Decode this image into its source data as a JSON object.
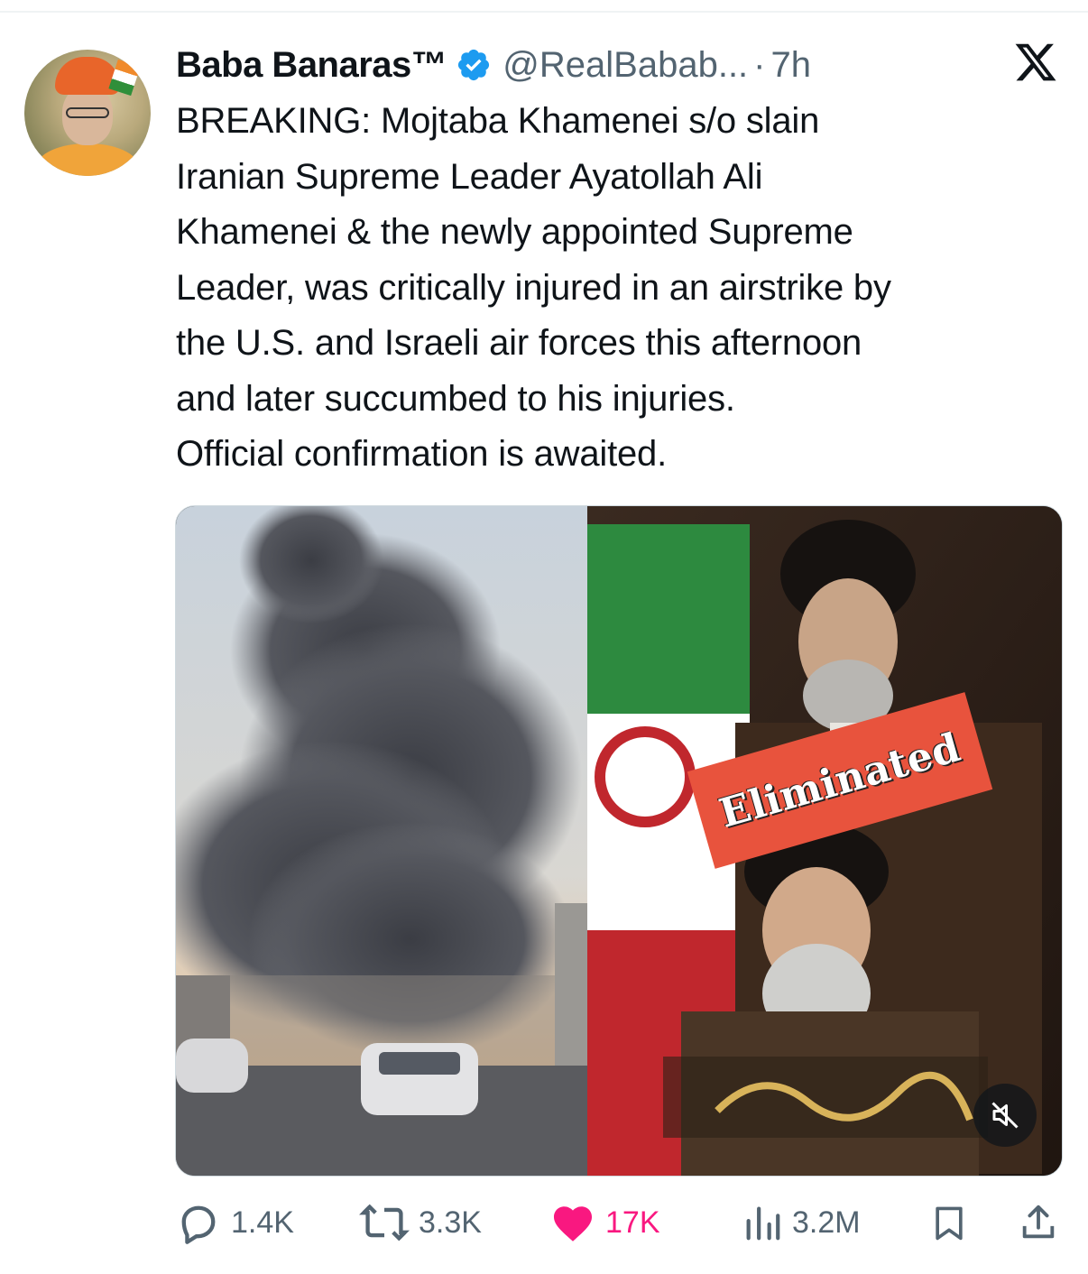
{
  "author": {
    "display_name": "Baba Banaras™",
    "handle": "@RealBabab...",
    "separator": "·",
    "time": "7h",
    "verified": true
  },
  "tweet": {
    "text": "BREAKING: Mojtaba Khamenei s/o slain\nIranian Supreme Leader Ayatollah Ali\nKhamenei & the newly appointed Supreme\nLeader, was critically injured in an airstrike by\nthe U.S. and Israeli air forces this afternoon\nand later succumbed to his injuries.\nOfficial confirmation is awaited."
  },
  "media": {
    "overlay_label": "Eliminated",
    "mute_icon": "speaker-muted-icon"
  },
  "actions": {
    "replies": "1.4K",
    "reposts": "3.3K",
    "likes": "17K",
    "views": "3.2M"
  },
  "colors": {
    "text": "#0f1419",
    "secondary": "#536471",
    "verified": "#1d9bf0",
    "like": "#f91880",
    "label": "#e8533d"
  },
  "icons": {
    "platform": "x-logo-icon",
    "reply": "speech-bubble-icon",
    "repost": "repost-arrows-icon",
    "like": "heart-filled-icon",
    "views": "bar-chart-icon",
    "bookmark": "bookmark-icon",
    "share": "share-upload-icon"
  }
}
